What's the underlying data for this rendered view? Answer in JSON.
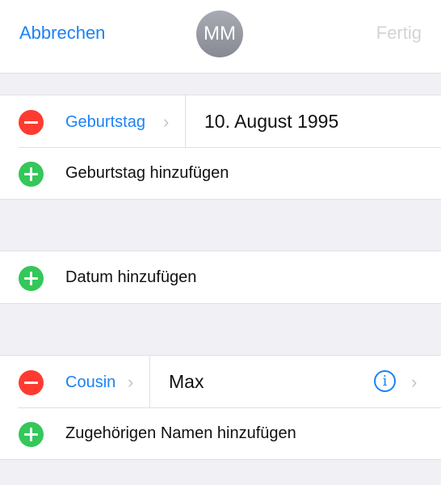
{
  "header": {
    "cancel_label": "Abbrechen",
    "avatar_initials": "MM",
    "done_label": "Fertig"
  },
  "birthday": {
    "label": "Geburtstag",
    "value": "10. August 1995",
    "add_label": "Geburtstag hinzufügen"
  },
  "dates": {
    "add_label": "Datum hinzufügen"
  },
  "related": {
    "label": "Cousin",
    "value": "Max",
    "info_glyph": "i",
    "add_label": "Zugehörigen Namen hinzufügen"
  },
  "icons": {
    "chevron": "›"
  },
  "colors": {
    "accent": "#1a82f7",
    "delete": "#fe3b30",
    "add": "#34c759",
    "disabled": "#d3d3d7"
  }
}
